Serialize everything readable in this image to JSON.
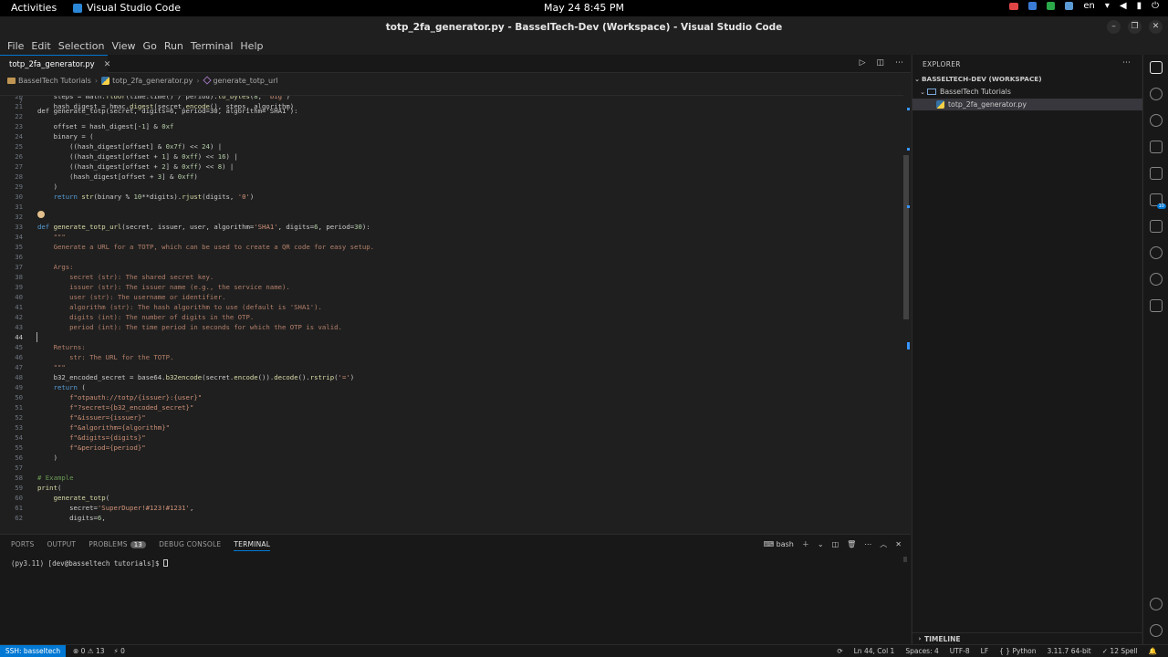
{
  "os": {
    "activities": "Activities",
    "app_name": "Visual Studio Code",
    "clock": "May 24  8:45 PM",
    "language": "en"
  },
  "window": {
    "title": "totp_2fa_generator.py - BasselTech-Dev (Workspace) - Visual Studio Code"
  },
  "menu": [
    "File",
    "Edit",
    "Selection",
    "View",
    "Go",
    "Run",
    "Terminal",
    "Help"
  ],
  "editor": {
    "tab_label": "totp_2fa_generator.py",
    "breadcrumb": [
      "BasselTech Tutorials",
      "totp_2fa_generator.py",
      "generate_totp_url"
    ],
    "sticky": "def generate_totp(secret, digits=6, period=30, algorithm='SHA1'):",
    "lines": [
      {
        "n": "20",
        "t": "    steps = math.floor(time.time() / period).to_bytes(8, 'big')"
      },
      {
        "n": "21",
        "t": "    hash_digest = hmac.digest(secret.encode(), steps, algorithm)"
      },
      {
        "n": "22",
        "t": ""
      },
      {
        "n": "23",
        "t": "    offset = hash_digest[-1] & 0xf"
      },
      {
        "n": "24",
        "t": "    binary = ("
      },
      {
        "n": "25",
        "t": "        ((hash_digest[offset] & 0x7f) << 24) |"
      },
      {
        "n": "26",
        "t": "        ((hash_digest[offset + 1] & 0xff) << 16) |"
      },
      {
        "n": "27",
        "t": "        ((hash_digest[offset + 2] & 0xff) << 8) |"
      },
      {
        "n": "28",
        "t": "        (hash_digest[offset + 3] & 0xff)"
      },
      {
        "n": "29",
        "t": "    )"
      },
      {
        "n": "30",
        "t": "    return str(binary % 10**digits).rjust(digits, '0')"
      },
      {
        "n": "31",
        "t": ""
      },
      {
        "n": "32",
        "t": ""
      },
      {
        "n": "33",
        "t": "def generate_totp_url(secret, issuer, user, algorithm='SHA1', digits=6, period=30):"
      },
      {
        "n": "34",
        "t": "    \"\"\""
      },
      {
        "n": "35",
        "t": "    Generate a URL for a TOTP, which can be used to create a QR code for easy setup."
      },
      {
        "n": "36",
        "t": ""
      },
      {
        "n": "37",
        "t": "    Args:"
      },
      {
        "n": "38",
        "t": "        secret (str): The shared secret key."
      },
      {
        "n": "39",
        "t": "        issuer (str): The issuer name (e.g., the service name)."
      },
      {
        "n": "40",
        "t": "        user (str): The username or identifier."
      },
      {
        "n": "41",
        "t": "        algorithm (str): The hash algorithm to use (default is 'SHA1')."
      },
      {
        "n": "42",
        "t": "        digits (int): The number of digits in the OTP."
      },
      {
        "n": "43",
        "t": "        period (int): The time period in seconds for which the OTP is valid."
      },
      {
        "n": "44",
        "t": ""
      },
      {
        "n": "45",
        "t": "    Returns:"
      },
      {
        "n": "46",
        "t": "        str: The URL for the TOTP."
      },
      {
        "n": "47",
        "t": "    \"\"\""
      },
      {
        "n": "48",
        "t": "    b32_encoded_secret = base64.b32encode(secret.encode()).decode().rstrip('=')"
      },
      {
        "n": "49",
        "t": "    return ("
      },
      {
        "n": "50",
        "t": "        f\"otpauth://totp/{issuer}:{user}\""
      },
      {
        "n": "51",
        "t": "        f\"?secret={b32_encoded_secret}\""
      },
      {
        "n": "52",
        "t": "        f\"&issuer={issuer}\""
      },
      {
        "n": "53",
        "t": "        f\"&algorithm={algorithm}\""
      },
      {
        "n": "54",
        "t": "        f\"&digits={digits}\""
      },
      {
        "n": "55",
        "t": "        f\"&period={period}\""
      },
      {
        "n": "56",
        "t": "    )"
      },
      {
        "n": "57",
        "t": ""
      },
      {
        "n": "58",
        "t": "# Example"
      },
      {
        "n": "59",
        "t": "print("
      },
      {
        "n": "60",
        "t": "    generate_totp("
      },
      {
        "n": "61",
        "t": "        secret='SuperDuper!#123!#1231',"
      },
      {
        "n": "62",
        "t": "        digits=6,"
      }
    ],
    "line_numbers_top": [
      "7",
      "20"
    ],
    "current_line": "44"
  },
  "panel": {
    "tabs": [
      "PORTS",
      "OUTPUT",
      "PROBLEMS",
      "DEBUG CONSOLE",
      "TERMINAL"
    ],
    "problems_count": "13",
    "active_tab": "TERMINAL",
    "shell": "bash",
    "prompt": "(py3.11) [dev@basseltech tutorials]$ "
  },
  "explorer": {
    "header": "EXPLORER",
    "workspace": "BASSELTECH-DEV (WORKSPACE)",
    "folder": "BasselTech Tutorials",
    "file": "totp_2fa_generator.py",
    "timeline": "TIMELINE"
  },
  "status": {
    "remote": "SSH: basseltech",
    "errors": "0",
    "warnings": "13",
    "ports": "0",
    "position": "Ln 44, Col 1",
    "spaces": "Spaces: 4",
    "encoding": "UTF-8",
    "eol": "LF",
    "language": "Python",
    "interpreter": "3.11.7 64-bit",
    "spell": "12 Spell"
  },
  "colors": {
    "accent": "#0078d4",
    "background": "#1f1f1f"
  }
}
